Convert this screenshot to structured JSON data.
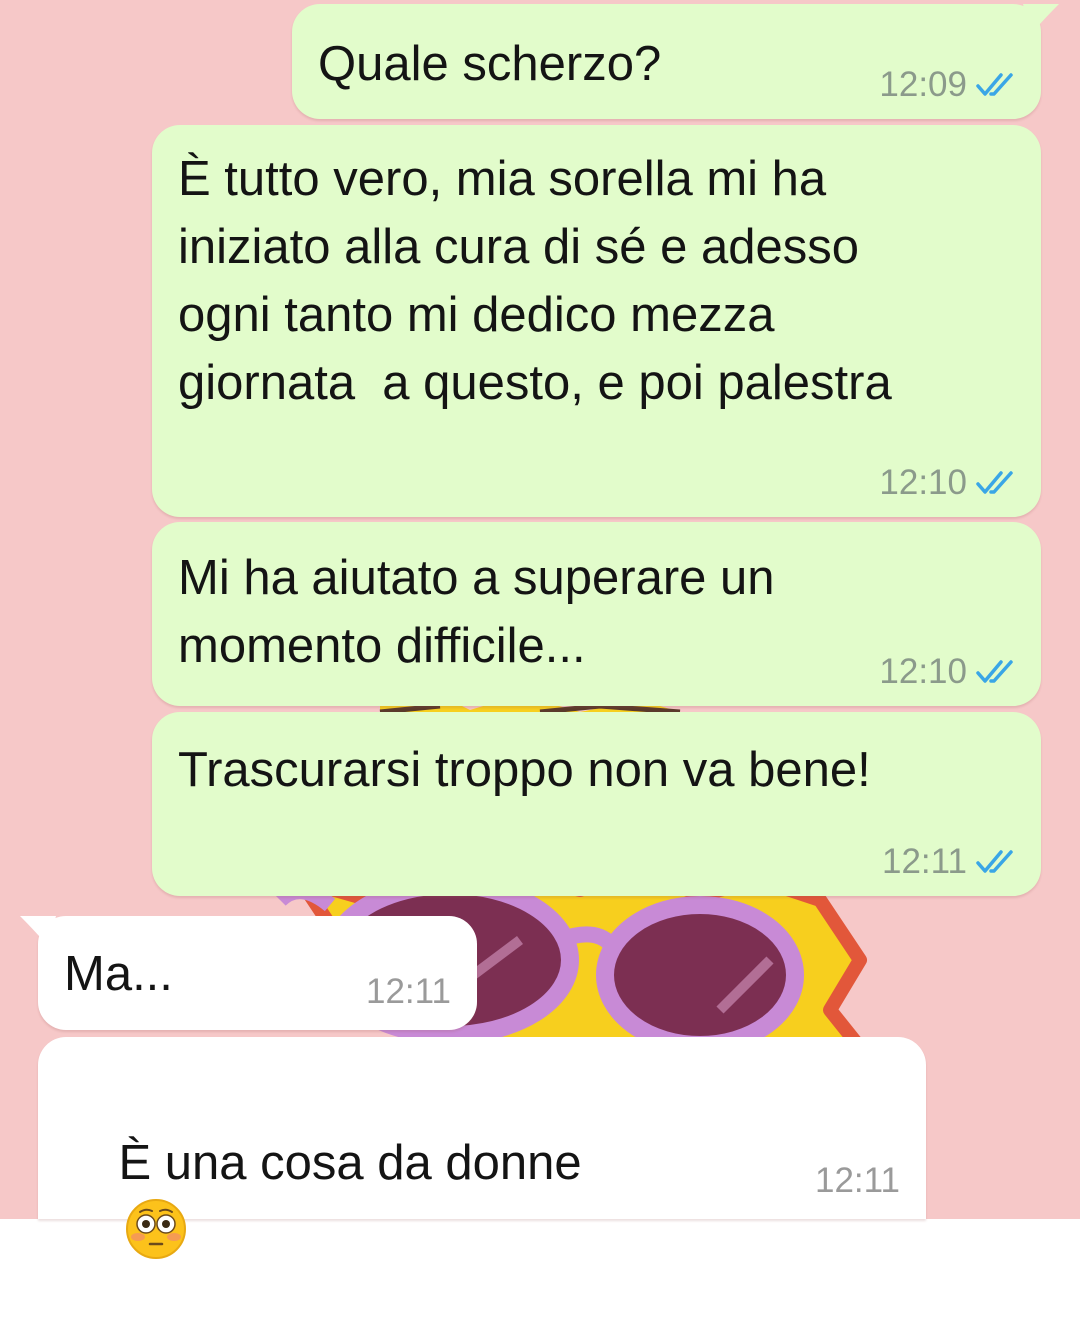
{
  "colors": {
    "wallpaper": "#f6c8c8",
    "outgoing_bubble": "#e2fccb",
    "incoming_bubble": "#ffffff",
    "read_ticks": "#3aa6e6"
  },
  "messages": [
    {
      "direction": "outgoing",
      "text": "Quale scherzo?",
      "time": "12:09",
      "status": "read"
    },
    {
      "direction": "outgoing",
      "text": "È tutto vero, mia sorella mi ha\niniziato alla cura di sé e adesso\nogni tanto mi dedico mezza\ngiornata  a questo, e poi palestra",
      "time": "12:10",
      "status": "read"
    },
    {
      "direction": "outgoing",
      "text": "Mi ha aiutato a superare un\nmomento difficile...",
      "time": "12:10",
      "status": "read"
    },
    {
      "direction": "outgoing",
      "text": "Trascurarsi troppo non va bene!",
      "time": "12:11",
      "status": "read"
    },
    {
      "direction": "incoming",
      "text": "Ma...",
      "time": "12:11"
    },
    {
      "direction": "incoming",
      "text": "È una cosa da donne",
      "emoji": "flushed-face",
      "time": "12:11"
    }
  ]
}
